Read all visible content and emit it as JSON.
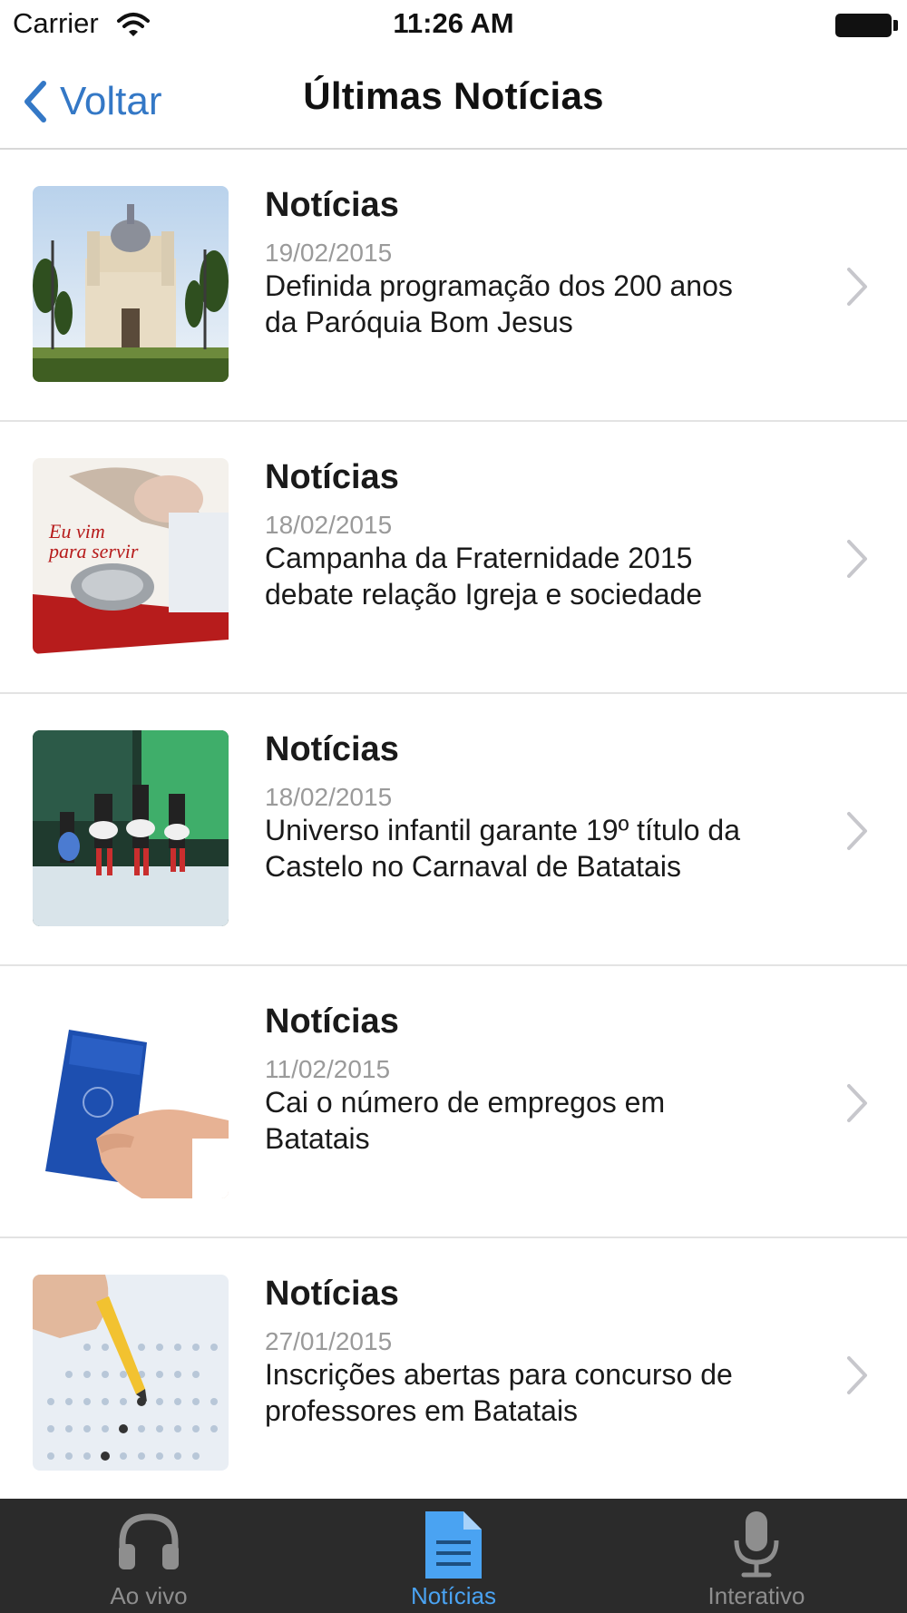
{
  "status_bar": {
    "carrier": "Carrier",
    "time": "11:26 AM"
  },
  "nav": {
    "back_label": "Voltar",
    "title": "Últimas Notícias"
  },
  "news": [
    {
      "category": "Notícias",
      "date": "19/02/2015",
      "headline_line1": "Definida programação dos 200 anos",
      "headline_line2": "da Paróquia Bom Jesus",
      "thumb_icon": "church-photo"
    },
    {
      "category": "Notícias",
      "date": "18/02/2015",
      "headline_line1": "Campanha da Fraternidade 2015",
      "headline_line2": "debate relação Igreja e sociedade",
      "thumb_icon": "campaign-poster-photo"
    },
    {
      "category": "Notícias",
      "date": "18/02/2015",
      "headline_line1": "Universo infantil garante 19º título da",
      "headline_line2": "Castelo no Carnaval de Batatais",
      "thumb_icon": "carnival-parade-photo"
    },
    {
      "category": "Notícias",
      "date": "11/02/2015",
      "headline_line1": "Cai o número de empregos em",
      "headline_line2": "Batatais",
      "thumb_icon": "work-card-photo"
    },
    {
      "category": "Notícias",
      "date": "27/01/2015",
      "headline_line1": "Inscrições abertas para concurso de",
      "headline_line2": "professores em Batatais",
      "thumb_icon": "exam-sheet-photo"
    }
  ],
  "tabs": [
    {
      "label": "Ao vivo",
      "icon": "headphones-icon",
      "active": false
    },
    {
      "label": "Notícias",
      "icon": "document-icon",
      "active": true
    },
    {
      "label": "Interativo",
      "icon": "microphone-icon",
      "active": false
    }
  ],
  "colors": {
    "accent": "#3478c6",
    "tab_active": "#4aa3f2",
    "tab_inactive": "#8e8e8e",
    "tab_bar_bg": "#2b2b2b"
  }
}
